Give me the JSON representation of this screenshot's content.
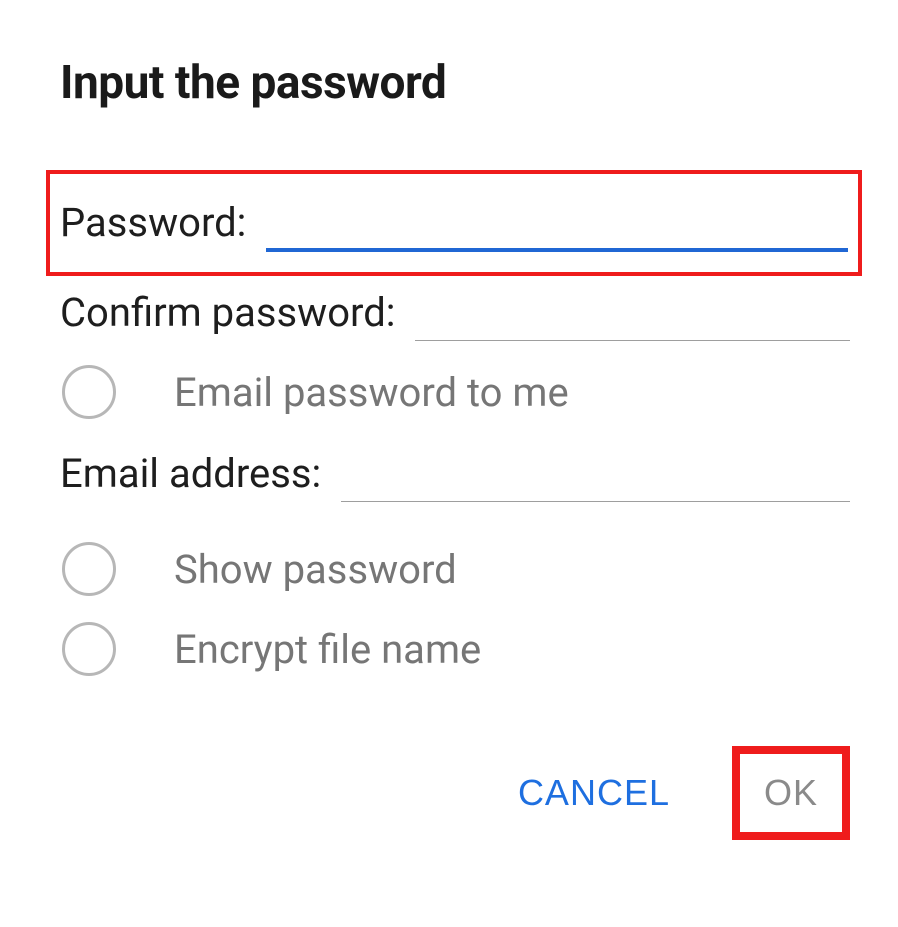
{
  "title": "Input the password",
  "fields": {
    "password_label": "Password:",
    "confirm_label": "Confirm password:",
    "email_address_label": "Email address:"
  },
  "options": {
    "email_to_me": "Email password to me",
    "show_password": "Show password",
    "encrypt_file_name": "Encrypt file name"
  },
  "buttons": {
    "cancel": "CANCEL",
    "ok": "OK"
  }
}
